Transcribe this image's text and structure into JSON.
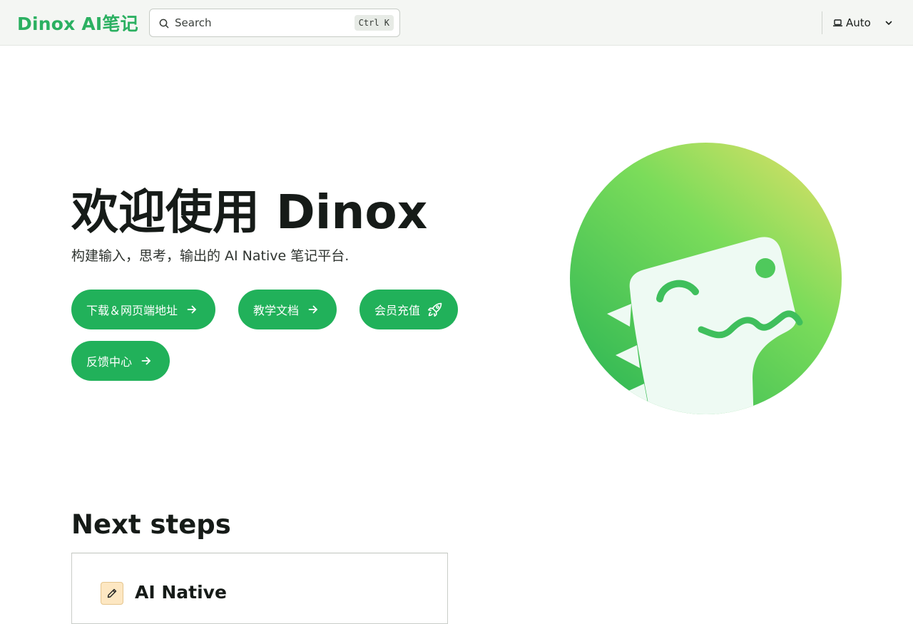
{
  "header": {
    "logo": "Dinox AI笔记",
    "search_placeholder": "Search",
    "search_shortcut": "Ctrl K",
    "theme_label": "Auto"
  },
  "hero": {
    "title": "欢迎使用 Dinox",
    "subtitle": "构建输入，思考，输出的 AI Native 笔记平台.",
    "buttons": [
      {
        "label": "下载＆网页端地址",
        "icon": "arrow-right-icon"
      },
      {
        "label": "教学文档",
        "icon": "arrow-right-icon"
      },
      {
        "label": "会员充值",
        "icon": "rocket-icon"
      },
      {
        "label": "反馈中心",
        "icon": "arrow-right-icon"
      }
    ]
  },
  "next_steps": {
    "heading": "Next steps",
    "cards": [
      {
        "title": "AI Native",
        "icon": "pencil-icon"
      }
    ]
  },
  "colors": {
    "brand_green": "#2bb061",
    "button_green": "#21b15a",
    "card_icon_bg": "#fde7c2"
  }
}
